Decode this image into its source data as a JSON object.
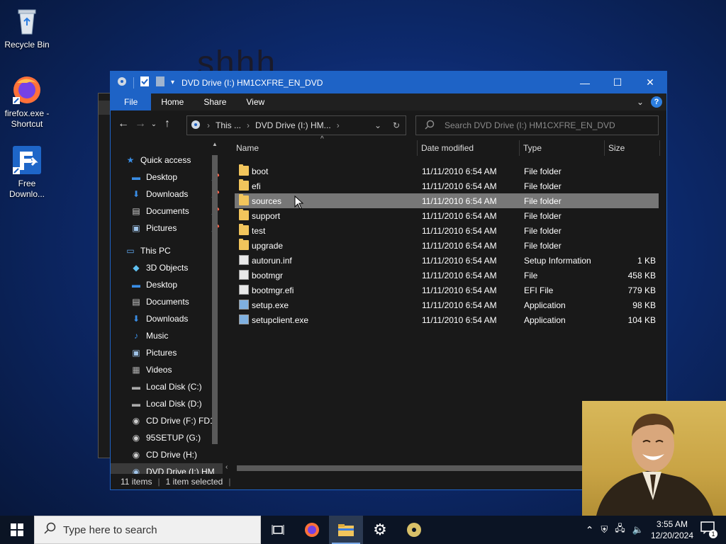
{
  "desktop": {
    "background_text": "shhh",
    "icons": [
      {
        "label": "Recycle Bin",
        "icon": "recycle-bin-icon"
      },
      {
        "label": "firefox.exe - Shortcut",
        "icon": "firefox-icon"
      },
      {
        "label": "Free Downlo...",
        "icon": "download-manager-icon"
      }
    ]
  },
  "window": {
    "title": "DVD Drive (I:) HM1CXFRE_EN_DVD",
    "ribbon": {
      "tabs": [
        "File",
        "Home",
        "Share",
        "View"
      ]
    },
    "address": {
      "segments": [
        "This ...",
        "DVD Drive (I:) HM..."
      ]
    },
    "search": {
      "placeholder": "Search DVD Drive (I:) HM1CXFRE_EN_DVD"
    },
    "nav_pane": [
      {
        "label": "Quick access",
        "icon": "star-icon",
        "pinned": false
      },
      {
        "label": "Desktop",
        "icon": "desktop-icon",
        "pinned": true
      },
      {
        "label": "Downloads",
        "icon": "download-arrow-icon",
        "pinned": true
      },
      {
        "label": "Documents",
        "icon": "documents-icon",
        "pinned": true
      },
      {
        "label": "Pictures",
        "icon": "pictures-icon",
        "pinned": true
      },
      {
        "label": "This PC",
        "icon": "computer-icon",
        "pinned": false
      },
      {
        "label": "3D Objects",
        "icon": "cube-icon",
        "pinned": false
      },
      {
        "label": "Desktop",
        "icon": "desktop-icon",
        "pinned": false
      },
      {
        "label": "Documents",
        "icon": "documents-icon",
        "pinned": false
      },
      {
        "label": "Downloads",
        "icon": "download-arrow-icon",
        "pinned": false
      },
      {
        "label": "Music",
        "icon": "music-icon",
        "pinned": false
      },
      {
        "label": "Pictures",
        "icon": "pictures-icon",
        "pinned": false
      },
      {
        "label": "Videos",
        "icon": "videos-icon",
        "pinned": false
      },
      {
        "label": "Local Disk (C:)",
        "icon": "drive-icon",
        "pinned": false
      },
      {
        "label": "Local Disk (D:)",
        "icon": "drive-icon",
        "pinned": false
      },
      {
        "label": "CD Drive (F:) FD1",
        "icon": "cd-icon",
        "pinned": false
      },
      {
        "label": "95SETUP (G:)",
        "icon": "cd-icon",
        "pinned": false
      },
      {
        "label": "CD Drive (H:)",
        "icon": "cd-icon",
        "pinned": false
      },
      {
        "label": "DVD Drive (I:) HM",
        "icon": "dvd-icon",
        "pinned": false
      }
    ],
    "columns": [
      "Name",
      "Date modified",
      "Type",
      "Size"
    ],
    "files": [
      {
        "name": "boot",
        "date": "11/11/2010 6:54 AM",
        "type": "File folder",
        "size": "",
        "kind": "folder"
      },
      {
        "name": "efi",
        "date": "11/11/2010 6:54 AM",
        "type": "File folder",
        "size": "",
        "kind": "folder"
      },
      {
        "name": "sources",
        "date": "11/11/2010 6:54 AM",
        "type": "File folder",
        "size": "",
        "kind": "folder"
      },
      {
        "name": "support",
        "date": "11/11/2010 6:54 AM",
        "type": "File folder",
        "size": "",
        "kind": "folder"
      },
      {
        "name": "test",
        "date": "11/11/2010 6:54 AM",
        "type": "File folder",
        "size": "",
        "kind": "folder"
      },
      {
        "name": "upgrade",
        "date": "11/11/2010 6:54 AM",
        "type": "File folder",
        "size": "",
        "kind": "folder"
      },
      {
        "name": "autorun.inf",
        "date": "11/11/2010 6:54 AM",
        "type": "Setup Information",
        "size": "1 KB",
        "kind": "file"
      },
      {
        "name": "bootmgr",
        "date": "11/11/2010 6:54 AM",
        "type": "File",
        "size": "458 KB",
        "kind": "file"
      },
      {
        "name": "bootmgr.efi",
        "date": "11/11/2010 6:54 AM",
        "type": "EFI File",
        "size": "779 KB",
        "kind": "file"
      },
      {
        "name": "setup.exe",
        "date": "11/11/2010 6:54 AM",
        "type": "Application",
        "size": "98 KB",
        "kind": "app"
      },
      {
        "name": "setupclient.exe",
        "date": "11/11/2010 6:54 AM",
        "type": "Application",
        "size": "104 KB",
        "kind": "app"
      }
    ],
    "selected_row": 2,
    "status": {
      "items": "11 items",
      "selected": "1 item selected"
    }
  },
  "taskbar": {
    "search_placeholder": "Type here to search",
    "time": "3:55 AM",
    "date": "12/20/2024",
    "notification_count": "1"
  },
  "colors": {
    "accent": "#1e63c6",
    "folder": "#f2c55c",
    "window_bg": "#191919"
  }
}
